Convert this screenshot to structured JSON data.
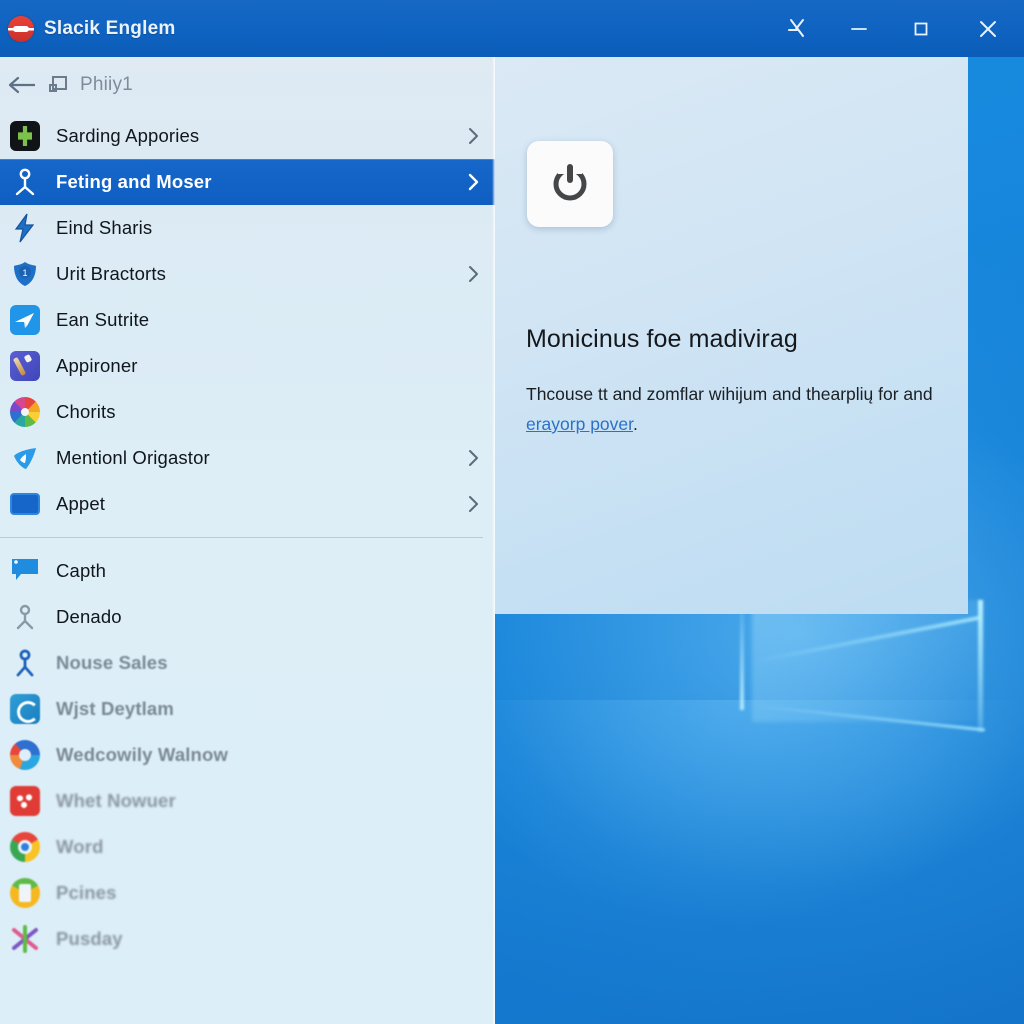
{
  "titlebar": {
    "app_title": "Slacik Englem",
    "logo_icon": "app-logo-icon",
    "buttons": [
      {
        "name": "pin-icon",
        "label": ""
      },
      {
        "name": "minimize-icon",
        "label": ""
      },
      {
        "name": "maximize-icon",
        "label": ""
      },
      {
        "name": "close-icon",
        "label": ""
      }
    ]
  },
  "sidebar": {
    "breadcrumb": {
      "back_icon": "back-arrow-icon",
      "page_icon": "window-icon",
      "label": "Phiiy1"
    },
    "groups": [
      {
        "items": [
          {
            "label": "Sarding Appories",
            "icon": "store-icon",
            "chevron": true,
            "selected": false,
            "state": "normal"
          },
          {
            "label": "Feting and Moser",
            "icon": "person-icon",
            "chevron": true,
            "selected": true,
            "state": "normal"
          },
          {
            "label": "Eind Sharis",
            "icon": "lightning-icon",
            "chevron": false,
            "selected": false,
            "state": "normal"
          },
          {
            "label": "Urit Bractorts",
            "icon": "shield-badge-icon",
            "chevron": true,
            "selected": false,
            "state": "normal"
          },
          {
            "label": "Ean Sutrite",
            "icon": "plane-icon",
            "chevron": false,
            "selected": false,
            "state": "normal"
          },
          {
            "label": "Appironer",
            "icon": "paintbrush-icon",
            "chevron": false,
            "selected": false,
            "state": "normal"
          },
          {
            "label": "Chorits",
            "icon": "color-wheel-icon",
            "chevron": false,
            "selected": false,
            "state": "normal"
          },
          {
            "label": "Mentionl Origastor",
            "icon": "shield-drop-icon",
            "chevron": true,
            "selected": false,
            "state": "normal"
          },
          {
            "label": "Appet",
            "icon": "display-icon",
            "chevron": true,
            "selected": false,
            "state": "normal"
          }
        ]
      },
      {
        "items": [
          {
            "label": "Capth",
            "icon": "chat-bubble-icon",
            "chevron": false,
            "selected": false,
            "state": "normal"
          },
          {
            "label": "Denado",
            "icon": "gray-person-icon",
            "chevron": false,
            "selected": false,
            "state": "normal"
          },
          {
            "label": "Nouse Sales",
            "icon": "blue-person-icon",
            "chevron": false,
            "selected": false,
            "state": "dim"
          },
          {
            "label": "Wjst Deytlam",
            "icon": "teal-app-icon",
            "chevron": false,
            "selected": false,
            "state": "dim"
          },
          {
            "label": "Wedcowily Walnow",
            "icon": "edge-icon",
            "chevron": false,
            "selected": false,
            "state": "dim"
          },
          {
            "label": "Whet Nowuer",
            "icon": "red-app-icon",
            "chevron": false,
            "selected": false,
            "state": "dim2"
          },
          {
            "label": "Word",
            "icon": "chrome-icon",
            "chevron": false,
            "selected": false,
            "state": "dim2"
          },
          {
            "label": "Pcines",
            "icon": "photos-icon",
            "chevron": false,
            "selected": false,
            "state": "dim2"
          },
          {
            "label": "Pusday",
            "icon": "star-app-icon",
            "chevron": false,
            "selected": false,
            "state": "dim2"
          }
        ]
      }
    ]
  },
  "pane": {
    "tile_icon": "power-icon",
    "heading": "Monicinus foe madivirag",
    "body_prefix": "Thcouse tt and zomflar wihijum and thearplių for and ",
    "body_link": "erayorp pover",
    "body_suffix": "."
  },
  "colors": {
    "accent": "#0f5fc2",
    "titlebar": "#0f63c0",
    "sidebar_bg": "#dceaf4",
    "pane_bg": "#cfe4f4",
    "link": "#2a72c8",
    "desktop": "#1580d6"
  }
}
